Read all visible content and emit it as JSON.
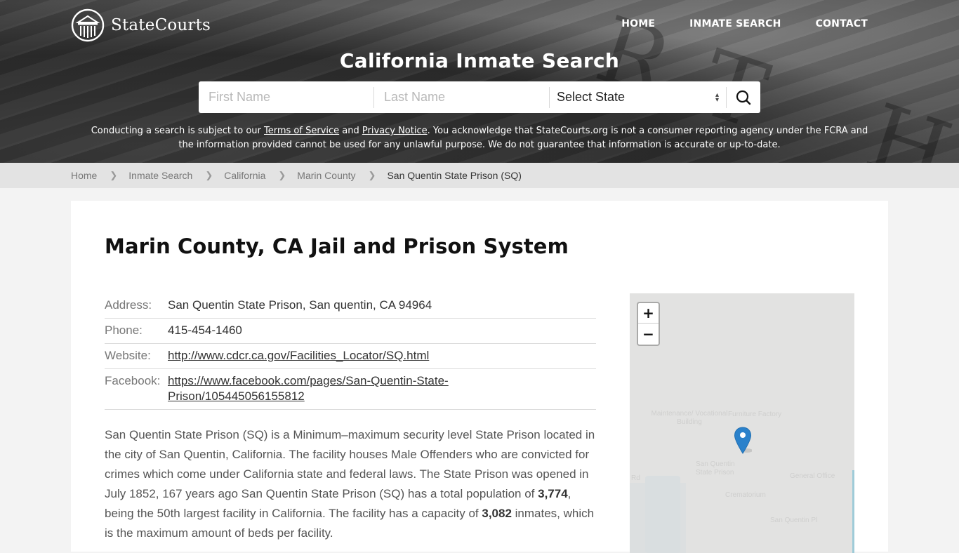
{
  "brand": {
    "name": "StateCourts",
    "logo_icon": "courthouse-columns-icon"
  },
  "nav": {
    "items": [
      {
        "label": "HOME"
      },
      {
        "label": "INMATE SEARCH"
      },
      {
        "label": "CONTACT"
      }
    ]
  },
  "hero": {
    "title": "California Inmate Search",
    "search": {
      "first_name_placeholder": "First Name",
      "first_name_value": "",
      "last_name_placeholder": "Last Name",
      "last_name_value": "",
      "state_select_value": "Select State",
      "search_icon": "search-icon"
    },
    "disclaimer": {
      "part1": "Conducting a search is subject to our ",
      "terms_link": "Terms of Service",
      "part2": " and ",
      "privacy_link": "Privacy Notice",
      "part3": ". You acknowledge that StateCourts.org is not a consumer reporting agency under the FCRA and the information provided cannot be used for any unlawful purpose. We do not guarantee that information is accurate or up-to-date."
    }
  },
  "breadcrumb": {
    "items": [
      {
        "label": "Home"
      },
      {
        "label": "Inmate Search"
      },
      {
        "label": "California"
      },
      {
        "label": "Marin County"
      }
    ],
    "current": "San Quentin State Prison (SQ)",
    "separator_icon": "chevron-right-icon"
  },
  "main": {
    "title": "Marin County, CA Jail and Prison System",
    "info": {
      "address_label": "Address:",
      "address_value": "San Quentin State Prison, San quentin, CA 94964",
      "phone_label": "Phone:",
      "phone_value": "415-454-1460",
      "website_label": "Website:",
      "website_value": "http://www.cdcr.ca.gov/Facilities_Locator/SQ.html",
      "facebook_label": "Facebook:",
      "facebook_value_line1": "https://www.facebook.com/pages/San-Quentin-State-",
      "facebook_value_line2": "Prison/105445056155812"
    },
    "description": {
      "text1": "San Quentin State Prison (SQ) is a Minimum–maximum security level State Prison located in the city of San Quentin, California. The facility houses Male Offenders who are convicted for crimes which come under California state and federal laws. The State Prison was opened in July 1852, 167 years ago San Quentin State Prison (SQ) has a total population of ",
      "population": "3,774",
      "text2": ", being the 50th largest facility in California. The facility has a capacity of ",
      "capacity": "3,082",
      "text3": " inmates, which is the maximum amount of beds per facility."
    }
  },
  "map": {
    "zoom_in_label": "+",
    "zoom_out_label": "−",
    "marker_icon": "map-marker-icon",
    "marker_color": "#2a81cb",
    "labels": [
      "Maintenance/ Vocational Building",
      "Furniture Factory",
      "San Quentin State Prison",
      "Crematorium",
      "General Office",
      "San Quentin Pl",
      "Rd"
    ]
  }
}
